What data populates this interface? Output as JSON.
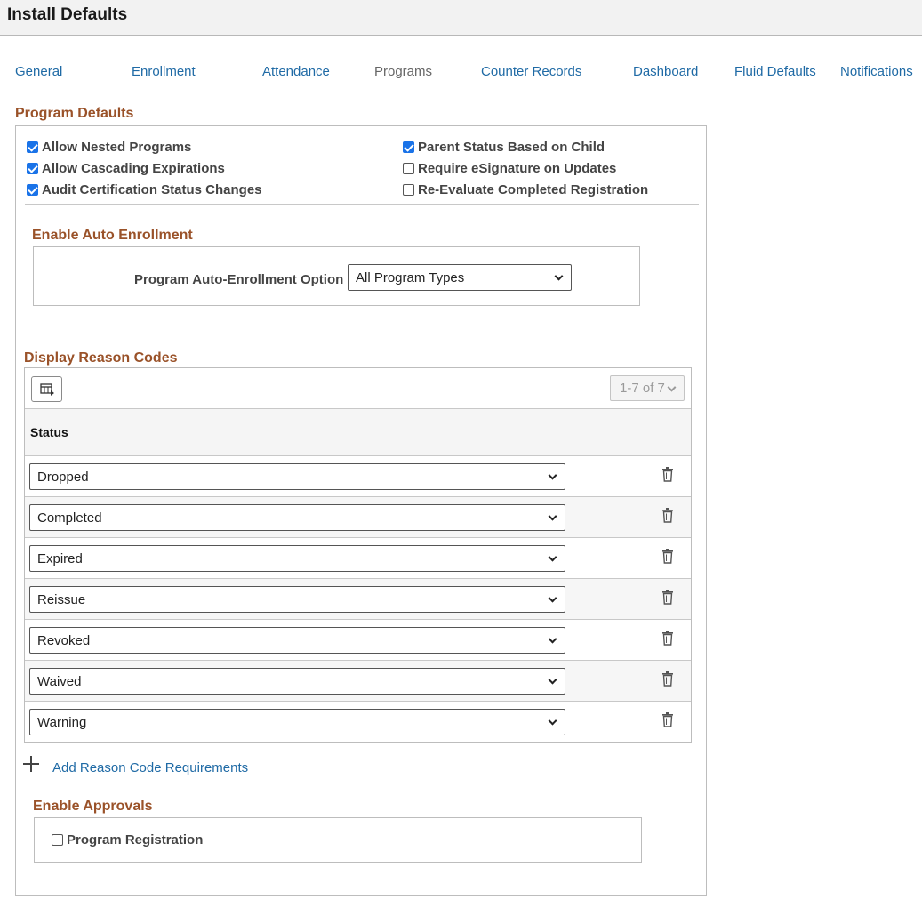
{
  "page": {
    "title": "Install Defaults"
  },
  "tabs": [
    {
      "label": "General",
      "active": false
    },
    {
      "label": "Enrollment",
      "active": false
    },
    {
      "label": "Attendance",
      "active": false
    },
    {
      "label": "Programs",
      "active": true
    },
    {
      "label": "Counter Records",
      "active": false
    },
    {
      "label": "Dashboard",
      "active": false
    },
    {
      "label": "Fluid Defaults",
      "active": false
    },
    {
      "label": "Notifications",
      "active": false
    }
  ],
  "program_defaults": {
    "title": "Program Defaults",
    "options": [
      {
        "label": "Allow Nested Programs",
        "checked": true
      },
      {
        "label": "Allow Cascading Expirations",
        "checked": true
      },
      {
        "label": "Audit Certification Status Changes",
        "checked": true
      },
      {
        "label": "Parent Status Based on Child",
        "checked": true
      },
      {
        "label": "Require eSignature on Updates",
        "checked": false
      },
      {
        "label": "Re-Evaluate Completed Registration",
        "checked": false
      }
    ]
  },
  "auto_enrollment": {
    "title": "Enable Auto Enrollment",
    "field_label": "Program Auto-Enrollment Option",
    "selected": "All Program Types"
  },
  "reason_codes": {
    "title": "Display Reason Codes",
    "pager": "1-7 of 7",
    "column_status": "Status",
    "rows": [
      {
        "status": "Dropped"
      },
      {
        "status": "Completed"
      },
      {
        "status": "Expired"
      },
      {
        "status": "Reissue"
      },
      {
        "status": "Revoked"
      },
      {
        "status": "Waived"
      },
      {
        "status": "Warning"
      }
    ],
    "add_label": "Add Reason Code Requirements"
  },
  "approvals": {
    "title": "Enable Approvals",
    "options": [
      {
        "label": "Program Registration",
        "checked": false
      }
    ]
  },
  "icons": {
    "grid_personalize": "grid-personalize-icon",
    "delete": "trash-icon",
    "add": "plus-icon",
    "dropdown": "chevron-down-icon"
  },
  "colors": {
    "link": "#1f6aa5",
    "section_title": "#9a5229",
    "checkbox_checked": "#1a73e8"
  }
}
